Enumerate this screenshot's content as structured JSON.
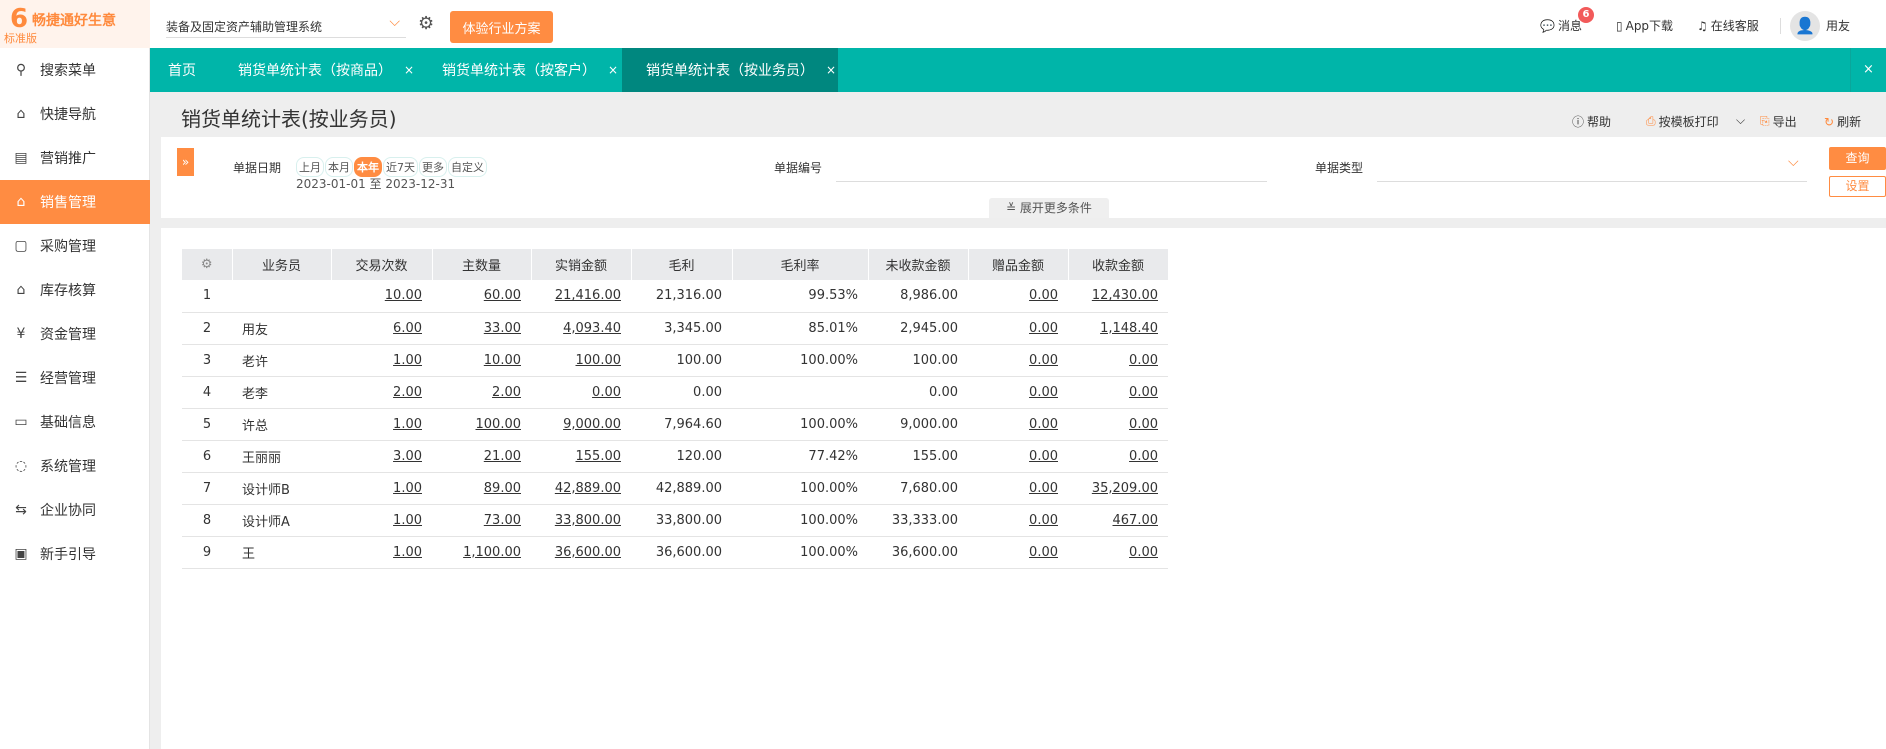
{
  "brand": {
    "name": "畅捷通好生意",
    "edition": "标准版",
    "logo_glyph": "6"
  },
  "topbar": {
    "system": "装备及固定资产辅助管理系统",
    "trial_label": "体验行业方案",
    "messages_label": "消息",
    "messages_count": "6",
    "app_label": "App下载",
    "service_label": "在线客服",
    "user": "用友"
  },
  "sidebar": {
    "items": [
      {
        "label": "搜索菜单",
        "icon": "search-icon",
        "glyph": "⚲"
      },
      {
        "label": "快捷导航",
        "icon": "home-icon",
        "glyph": "⌂"
      },
      {
        "label": "营销推广",
        "icon": "gift-icon",
        "glyph": "▤"
      },
      {
        "label": "销售管理",
        "icon": "sales-icon",
        "glyph": "⌂"
      },
      {
        "label": "采购管理",
        "icon": "bag-icon",
        "glyph": "▢"
      },
      {
        "label": "库存核算",
        "icon": "warehouse-icon",
        "glyph": "⌂"
      },
      {
        "label": "资金管理",
        "icon": "money-bag-icon",
        "glyph": "¥"
      },
      {
        "label": "经营管理",
        "icon": "clipboard-icon",
        "glyph": "☰"
      },
      {
        "label": "基础信息",
        "icon": "id-card-icon",
        "glyph": "▭"
      },
      {
        "label": "系统管理",
        "icon": "nodes-icon",
        "glyph": "◌"
      },
      {
        "label": "企业协同",
        "icon": "sync-icon",
        "glyph": "⇆"
      },
      {
        "label": "新手引导",
        "icon": "guide-icon",
        "glyph": "▣"
      }
    ],
    "active": "销售管理"
  },
  "tabs": [
    {
      "label": "首页"
    },
    {
      "label": "销货单统计表（按商品）",
      "close": "×"
    },
    {
      "label": "销货单统计表（按客户）",
      "close": "×"
    },
    {
      "label": "销货单统计表（按业务员）",
      "close": "×",
      "active": true
    }
  ],
  "close_all": "×",
  "page": {
    "title": "销货单统计表(按业务员)",
    "help": "帮助",
    "print": "按模板打印",
    "export": "导出",
    "refresh": "刷新"
  },
  "filter": {
    "date_label": "单据日期",
    "chips": [
      "上月",
      "本月",
      "本年",
      "近7天",
      "更多",
      "自定义"
    ],
    "active_chip": "本年",
    "date_range": "2023-01-01 至 2023-12-31",
    "number_label": "单据编号",
    "number_value": "",
    "type_label": "单据类型",
    "type_value": "",
    "query": "查询",
    "settings": "设置",
    "more": "展开更多条件"
  },
  "table": {
    "columns": [
      "业务员",
      "交易次数",
      "主数量",
      "实销金额",
      "毛利",
      "毛利率",
      "未收款金额",
      "赠品金额",
      "收款金额"
    ],
    "rows": [
      [
        "1",
        "",
        "10.00",
        "60.00",
        "21,416.00",
        "21,316.00",
        "99.53%",
        "8,986.00",
        "0.00",
        "12,430.00"
      ],
      [
        "2",
        "用友",
        "6.00",
        "33.00",
        "4,093.40",
        "3,345.00",
        "85.01%",
        "2,945.00",
        "0.00",
        "1,148.40"
      ],
      [
        "3",
        "老许",
        "1.00",
        "10.00",
        "100.00",
        "100.00",
        "100.00%",
        "100.00",
        "0.00",
        "0.00"
      ],
      [
        "4",
        "老李",
        "2.00",
        "2.00",
        "0.00",
        "0.00",
        "",
        "0.00",
        "0.00",
        "0.00"
      ],
      [
        "5",
        "许总",
        "1.00",
        "100.00",
        "9,000.00",
        "7,964.60",
        "100.00%",
        "9,000.00",
        "0.00",
        "0.00"
      ],
      [
        "6",
        "王丽丽",
        "3.00",
        "21.00",
        "155.00",
        "120.00",
        "77.42%",
        "155.00",
        "0.00",
        "0.00"
      ],
      [
        "7",
        "设计师B",
        "1.00",
        "89.00",
        "42,889.00",
        "42,889.00",
        "100.00%",
        "7,680.00",
        "0.00",
        "35,209.00"
      ],
      [
        "8",
        "设计师A",
        "1.00",
        "73.00",
        "33,800.00",
        "33,800.00",
        "100.00%",
        "33,333.00",
        "0.00",
        "467.00"
      ],
      [
        "9",
        "王",
        "1.00",
        "1,100.00",
        "36,600.00",
        "36,600.00",
        "100.00%",
        "36,600.00",
        "0.00",
        "0.00"
      ]
    ]
  },
  "colors": {
    "accent": "#ff8c42",
    "teal": "#00b5a9",
    "teal_active": "#00877f"
  }
}
